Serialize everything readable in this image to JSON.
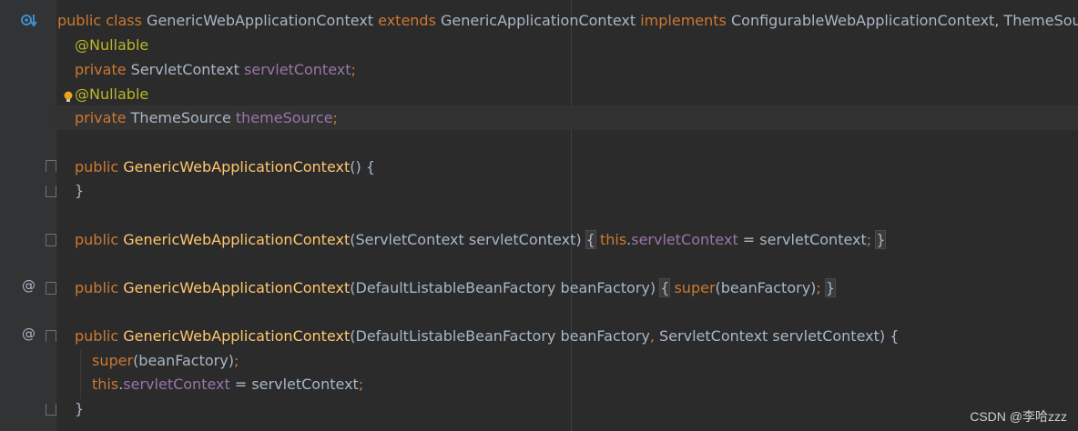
{
  "editor": {
    "lines": [
      {
        "tokens": [
          [
            "kw",
            "public "
          ],
          [
            "kw",
            "class "
          ],
          [
            "plain",
            "GenericWebApplicationContext "
          ],
          [
            "kw",
            "extends "
          ],
          [
            "plain",
            "GenericApplicationContext "
          ],
          [
            "kw",
            "implements "
          ],
          [
            "plain",
            "ConfigurableWebApplicationContext, ThemeSource {"
          ]
        ]
      },
      {
        "tokens": [
          [
            "ann",
            "@Nullable"
          ]
        ]
      },
      {
        "tokens": [
          [
            "kw",
            "private "
          ],
          [
            "plain",
            "ServletContext "
          ],
          [
            "fld",
            "servletContext"
          ],
          [
            "kw",
            ";"
          ]
        ]
      },
      {
        "tokens": [
          [
            "ann",
            "@Nullable"
          ]
        ]
      },
      {
        "tokens": [
          [
            "kw",
            "private "
          ],
          [
            "plain",
            "ThemeSource "
          ],
          [
            "fld",
            "themeSource"
          ],
          [
            "kw",
            ";"
          ]
        ]
      },
      {
        "tokens": []
      },
      {
        "tokens": [
          [
            "kw",
            "public "
          ],
          [
            "fn",
            "GenericWebApplicationContext"
          ],
          [
            "plain",
            "() {"
          ]
        ]
      },
      {
        "tokens": [
          [
            "plain",
            "}"
          ]
        ]
      },
      {
        "tokens": []
      },
      {
        "tokens": [
          [
            "kw",
            "public "
          ],
          [
            "fn",
            "GenericWebApplicationContext"
          ],
          [
            "plain",
            "(ServletContext servletContext) "
          ],
          [
            "brace",
            "{"
          ],
          [
            "plain",
            " "
          ],
          [
            "kw",
            "this"
          ],
          [
            "plain",
            "."
          ],
          [
            "fld",
            "servletContext"
          ],
          [
            "plain",
            " = servletContext"
          ],
          [
            "kw",
            ";"
          ],
          [
            "plain",
            " "
          ],
          [
            "brace",
            "}"
          ]
        ]
      },
      {
        "tokens": []
      },
      {
        "tokens": [
          [
            "kw",
            "public "
          ],
          [
            "fn",
            "GenericWebApplicationContext"
          ],
          [
            "plain",
            "(DefaultListableBeanFactory beanFactory) "
          ],
          [
            "brace",
            "{"
          ],
          [
            "plain",
            " "
          ],
          [
            "kw",
            "super"
          ],
          [
            "plain",
            "(beanFactory)"
          ],
          [
            "kw",
            ";"
          ],
          [
            "plain",
            " "
          ],
          [
            "brace",
            "}"
          ]
        ]
      },
      {
        "tokens": []
      },
      {
        "tokens": [
          [
            "kw",
            "public "
          ],
          [
            "fn",
            "GenericWebApplicationContext"
          ],
          [
            "plain",
            "(DefaultListableBeanFactory beanFactory"
          ],
          [
            "kw",
            ", "
          ],
          [
            "plain",
            "ServletContext servletContext) {"
          ]
        ]
      },
      {
        "tokens": [
          [
            "kw",
            "super"
          ],
          [
            "plain",
            "(beanFactory)"
          ],
          [
            "kw",
            ";"
          ]
        ]
      },
      {
        "tokens": [
          [
            "kw",
            "this"
          ],
          [
            "plain",
            "."
          ],
          [
            "fld",
            "servletContext"
          ],
          [
            "plain",
            " = servletContext"
          ],
          [
            "kw",
            ";"
          ]
        ]
      },
      {
        "tokens": [
          [
            "plain",
            "}"
          ]
        ]
      }
    ]
  },
  "gutter": {
    "class_marker_icon": "override-implement-icon",
    "bulb_icon": "intention-bulb-icon",
    "at_symbol": "@"
  },
  "watermark": "CSDN @李哈zzz"
}
